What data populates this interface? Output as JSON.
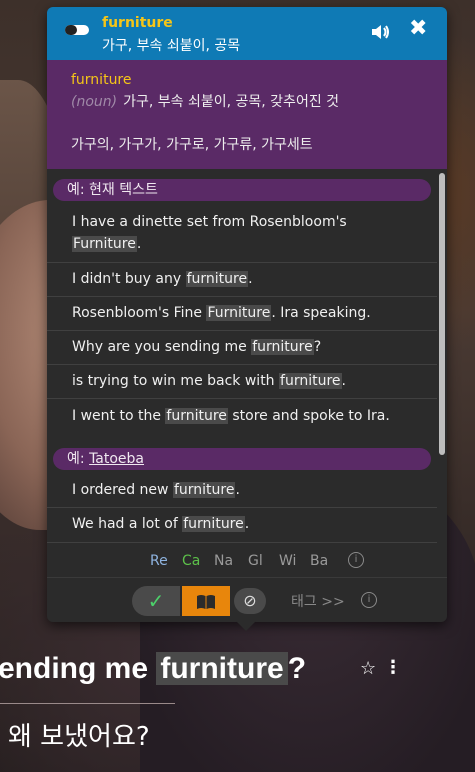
{
  "popup": {
    "header": {
      "word": "furniture",
      "translation": "가구, 부속 쇠붙이, 공목"
    },
    "definition": {
      "word": "furniture",
      "part_of_speech": "(noun)",
      "meaning": "가구, 부속 쇠붙이, 공목, 갖추어진 것",
      "forms": "가구의, 가구가, 가구로, 가구류, 가구세트"
    },
    "sections": [
      {
        "label": "예: 현재 텍스트",
        "examples": [
          {
            "before": "I have a dinette set from Rosenbloom's ",
            "word": "Furniture",
            "after": "."
          },
          {
            "before": "I didn't buy any ",
            "word": "furniture",
            "after": "."
          },
          {
            "before": "Rosenbloom's Fine ",
            "word": "Furniture",
            "after": ". Ira speaking."
          },
          {
            "before": "Why are you sending me ",
            "word": "furniture",
            "after": "?"
          },
          {
            "before": "is trying to win me back with ",
            "word": "furniture",
            "after": "."
          },
          {
            "before": "I went to the ",
            "word": "furniture",
            "after": " store and spoke to Ira."
          }
        ]
      },
      {
        "label_prefix": "예: ",
        "label_link": "Tatoeba",
        "examples": [
          {
            "before": "I ordered new ",
            "word": "furniture",
            "after": "."
          },
          {
            "before": "We had a lot of ",
            "word": "furniture",
            "after": "."
          }
        ]
      }
    ],
    "sources": [
      {
        "label": "Re",
        "color": "#8fb4e0"
      },
      {
        "label": "Ca",
        "color": "#5cc04a"
      },
      {
        "label": "Na",
        "color": "#9a9a9a"
      },
      {
        "label": "Gl",
        "color": "#9a9a9a"
      },
      {
        "label": "Wi",
        "color": "#9a9a9a"
      },
      {
        "label": "Ba",
        "color": "#9a9a9a"
      }
    ],
    "toolbar": {
      "tags_label": "태그 >>"
    },
    "icons": {
      "info": "i",
      "check": "✓",
      "ban": "⊘"
    }
  },
  "subtitle": {
    "before": "ending me ",
    "word": "furniture",
    "after": "?",
    "translation": "왜 보냈어요?"
  },
  "colors": {
    "header_bg": "#0f7ab5",
    "definition_bg": "#5a2a66",
    "headword": "#f5c518",
    "book_button": "#e8860c",
    "check": "#4cd06a"
  }
}
